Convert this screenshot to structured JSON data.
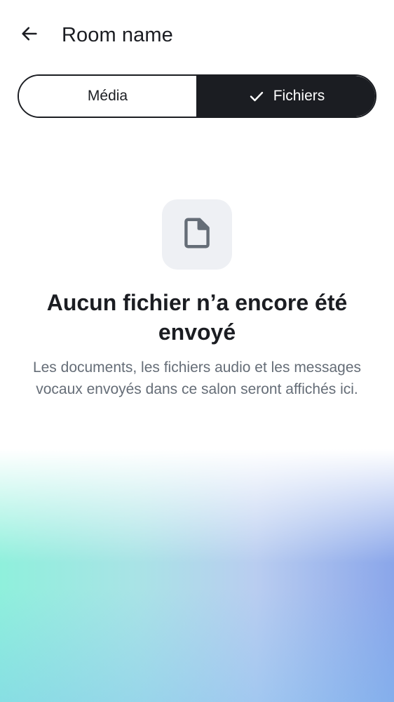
{
  "header": {
    "back_icon": "arrow-left-icon",
    "title": "Room name"
  },
  "tabs": {
    "items": [
      {
        "label": "Média",
        "selected": false
      },
      {
        "label": "Fichiers",
        "selected": true,
        "icon": "check-icon"
      }
    ]
  },
  "empty_state": {
    "icon": "document-icon",
    "title": "Aucun fichier n’a encore été envoyé",
    "description": "Les documents, les fichiers audio et les messages vocaux envoyés dans ce salon seront affichés ici."
  },
  "colors": {
    "text_primary": "#1b1d22",
    "text_secondary": "#656d77",
    "tile_bg": "#eef0f4",
    "gradient_left": "#8ff0dc",
    "gradient_right": "#8aa6ea"
  }
}
